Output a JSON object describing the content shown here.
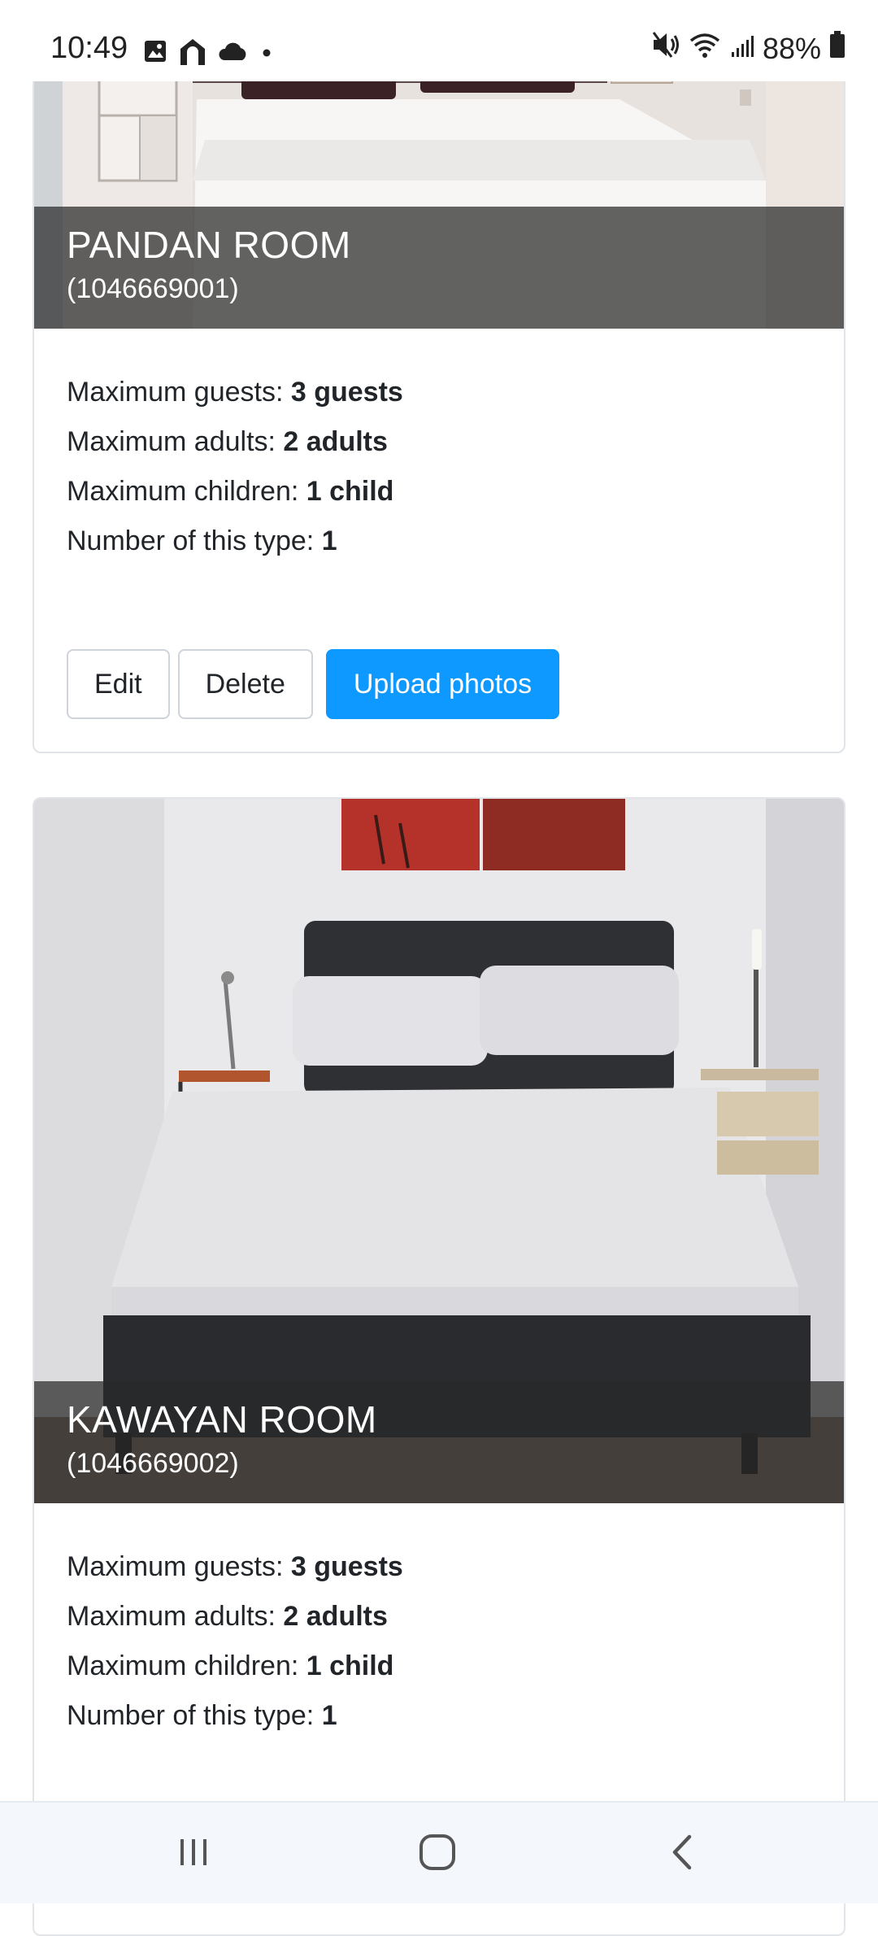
{
  "status_bar": {
    "time": "10:49",
    "battery": "88%",
    "icons": [
      "gallery-icon",
      "home-icon",
      "cloud-icon",
      "dot-icon",
      "mute-icon",
      "wifi-icon",
      "signal-icon",
      "battery-icon"
    ]
  },
  "rooms": [
    {
      "name": "PANDAN ROOM",
      "id": "(1046669001)",
      "guests_label": "Maximum guests: ",
      "guests_value": "3 guests",
      "adults_label": "Maximum adults: ",
      "adults_value": "2 adults",
      "children_label": "Maximum children: ",
      "children_value": "1 child",
      "count_label": "Number of this type: ",
      "count_value": "1",
      "actions": {
        "edit": "Edit",
        "delete": "Delete",
        "upload": "Upload photos"
      }
    },
    {
      "name": "KAWAYAN ROOM",
      "id": "(1046669002)",
      "guests_label": "Maximum guests: ",
      "guests_value": "3 guests",
      "adults_label": "Maximum adults: ",
      "adults_value": "2 adults",
      "children_label": "Maximum children: ",
      "children_value": "1 child",
      "count_label": "Number of this type: ",
      "count_value": "1"
    }
  ],
  "nav_bar": {
    "icons": [
      "recent-apps-icon",
      "home-button-icon",
      "back-icon"
    ]
  },
  "colors": {
    "primary": "#0d99ff",
    "overlay": "#282828",
    "border": "#e1e4e8"
  }
}
